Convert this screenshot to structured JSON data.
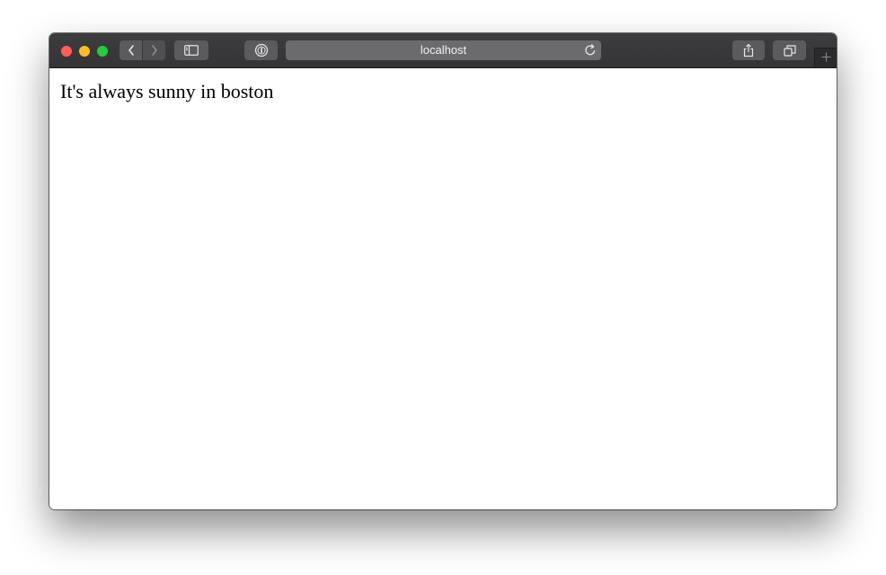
{
  "browser": {
    "address_bar": {
      "url": "localhost"
    },
    "icons": {
      "close": "close-light-icon",
      "minimize": "minimize-light-icon",
      "maximize": "maximize-light-icon",
      "back": "chevron-left-icon",
      "forward": "chevron-right-icon",
      "sidebar": "sidebar-icon",
      "password": "password-manager-icon",
      "reload": "reload-icon",
      "share": "share-icon",
      "tabs": "tabs-overview-icon",
      "new_tab": "plus-icon"
    },
    "colors": {
      "close": "#fe5f57",
      "minimize": "#febc2e",
      "maximize": "#28c840",
      "titlebar": "#3d3d3f"
    }
  },
  "page": {
    "text": "It's always sunny in boston"
  }
}
